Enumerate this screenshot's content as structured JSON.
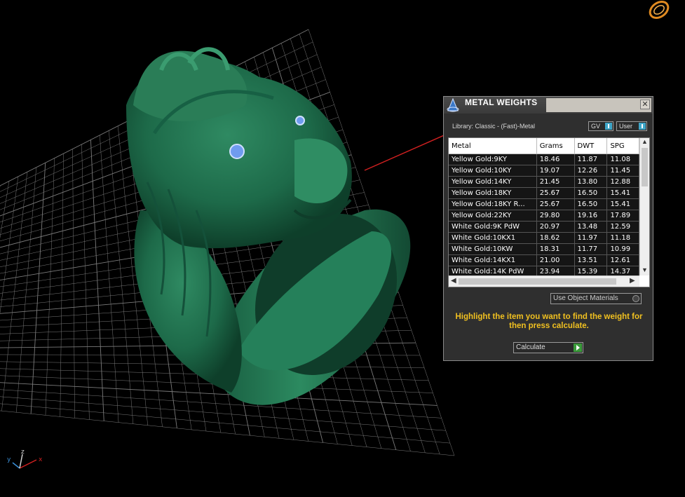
{
  "dialog": {
    "title": "METAL WEIGHTS",
    "close_glyph": "✕",
    "library_label": "Library: Classic - (Fast)-Metal",
    "gv_toggle_label": "GV",
    "user_toggle_label": "User",
    "columns": [
      "Metal",
      "Grams",
      "DWT",
      "SPG"
    ],
    "rows": [
      [
        "Yellow Gold:9KY",
        "18.46",
        "11.87",
        "11.08"
      ],
      [
        "Yellow Gold:10KY",
        "19.07",
        "12.26",
        "11.45"
      ],
      [
        "Yellow Gold:14KY",
        "21.45",
        "13.80",
        "12.88"
      ],
      [
        "Yellow Gold:18KY",
        "25.67",
        "16.50",
        "15.41"
      ],
      [
        "Yellow Gold:18KY R...",
        "25.67",
        "16.50",
        "15.41"
      ],
      [
        "Yellow Gold:22KY",
        "29.80",
        "19.16",
        "17.89"
      ],
      [
        "White Gold:9K PdW",
        "20.97",
        "13.48",
        "12.59"
      ],
      [
        "White Gold:10KX1",
        "18.62",
        "11.97",
        "11.18"
      ],
      [
        "White Gold:10KW",
        "18.31",
        "11.77",
        "10.99"
      ],
      [
        "White Gold:14KX1",
        "21.00",
        "13.51",
        "12.61"
      ],
      [
        "White Gold:14K PdW",
        "23.94",
        "15.39",
        "14.37"
      ]
    ],
    "use_object_materials_label": "Use Object Materials",
    "instructions": "Highlight the item you want to find the weight for then press calculate.",
    "calculate_label": "Calculate"
  },
  "viewport": {
    "axis_x": "x",
    "axis_y": "y",
    "axis_z": "z",
    "ring_color": "#1f6e4c",
    "gem_color": "#6f9bef",
    "grid_color": "#7a7a7a",
    "axis_red": "#d02020"
  },
  "icons": {
    "app": "metal-weights-icon",
    "corner": "ring-logo-icon"
  }
}
